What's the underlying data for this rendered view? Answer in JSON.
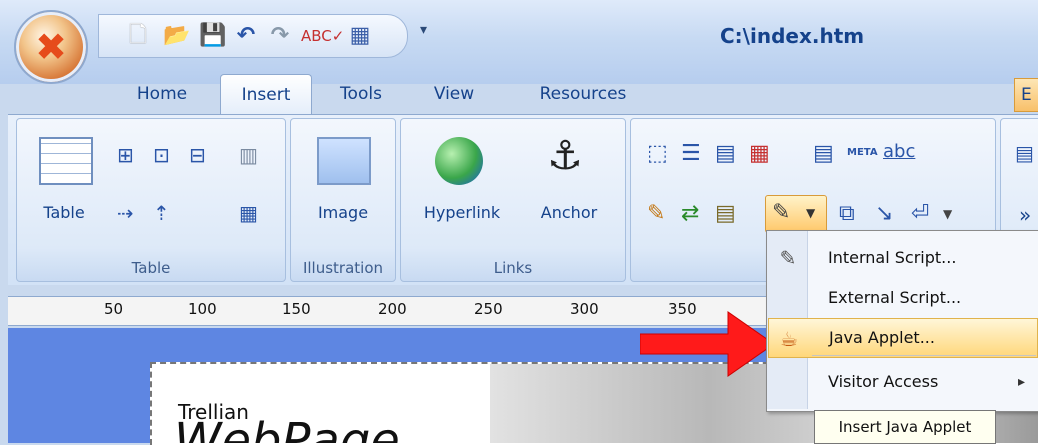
{
  "window": {
    "title": "C:\\index.htm"
  },
  "quick_access": {
    "items": [
      "new-doc-icon",
      "open-folder-icon",
      "save-icon",
      "undo-icon",
      "redo-icon",
      "spellcheck-icon",
      "table-icon"
    ],
    "dropdown_glyph": "▾"
  },
  "tabs": [
    {
      "label": "Home"
    },
    {
      "label": "Insert",
      "active": true
    },
    {
      "label": "Tools"
    },
    {
      "label": "View"
    },
    {
      "label": "Resources"
    }
  ],
  "tab_overflow": "E",
  "ribbon": {
    "table_group": {
      "label": "Table",
      "button": "Table"
    },
    "illustration_group": {
      "label": "Illustration",
      "button": "Image"
    },
    "links_group": {
      "label": "Links",
      "hyperlink": "Hyperlink",
      "anchor": "Anchor"
    },
    "meta_text": "META",
    "abc_text": "abc",
    "overflow": "»"
  },
  "ruler": [
    "50",
    "100",
    "150",
    "200",
    "250",
    "300",
    "350"
  ],
  "menu": {
    "items": [
      {
        "label": "Internal Script...",
        "icon": "script-pencil-icon"
      },
      {
        "label": "External Script...",
        "icon": ""
      },
      {
        "label": "Java Applet...",
        "icon": "java-cup-icon",
        "highlighted": true
      },
      {
        "label": "Visitor Access",
        "icon": "",
        "submenu": "▸"
      }
    ]
  },
  "tooltip": "Insert Java Applet",
  "page_text": {
    "line1": "Trellian",
    "line2": "WebPage"
  },
  "colors": {
    "accent": "#15428b",
    "arrow": "#ff1a1a",
    "editor_bg": "#5e86e2",
    "highlight": "#ffd77a"
  }
}
